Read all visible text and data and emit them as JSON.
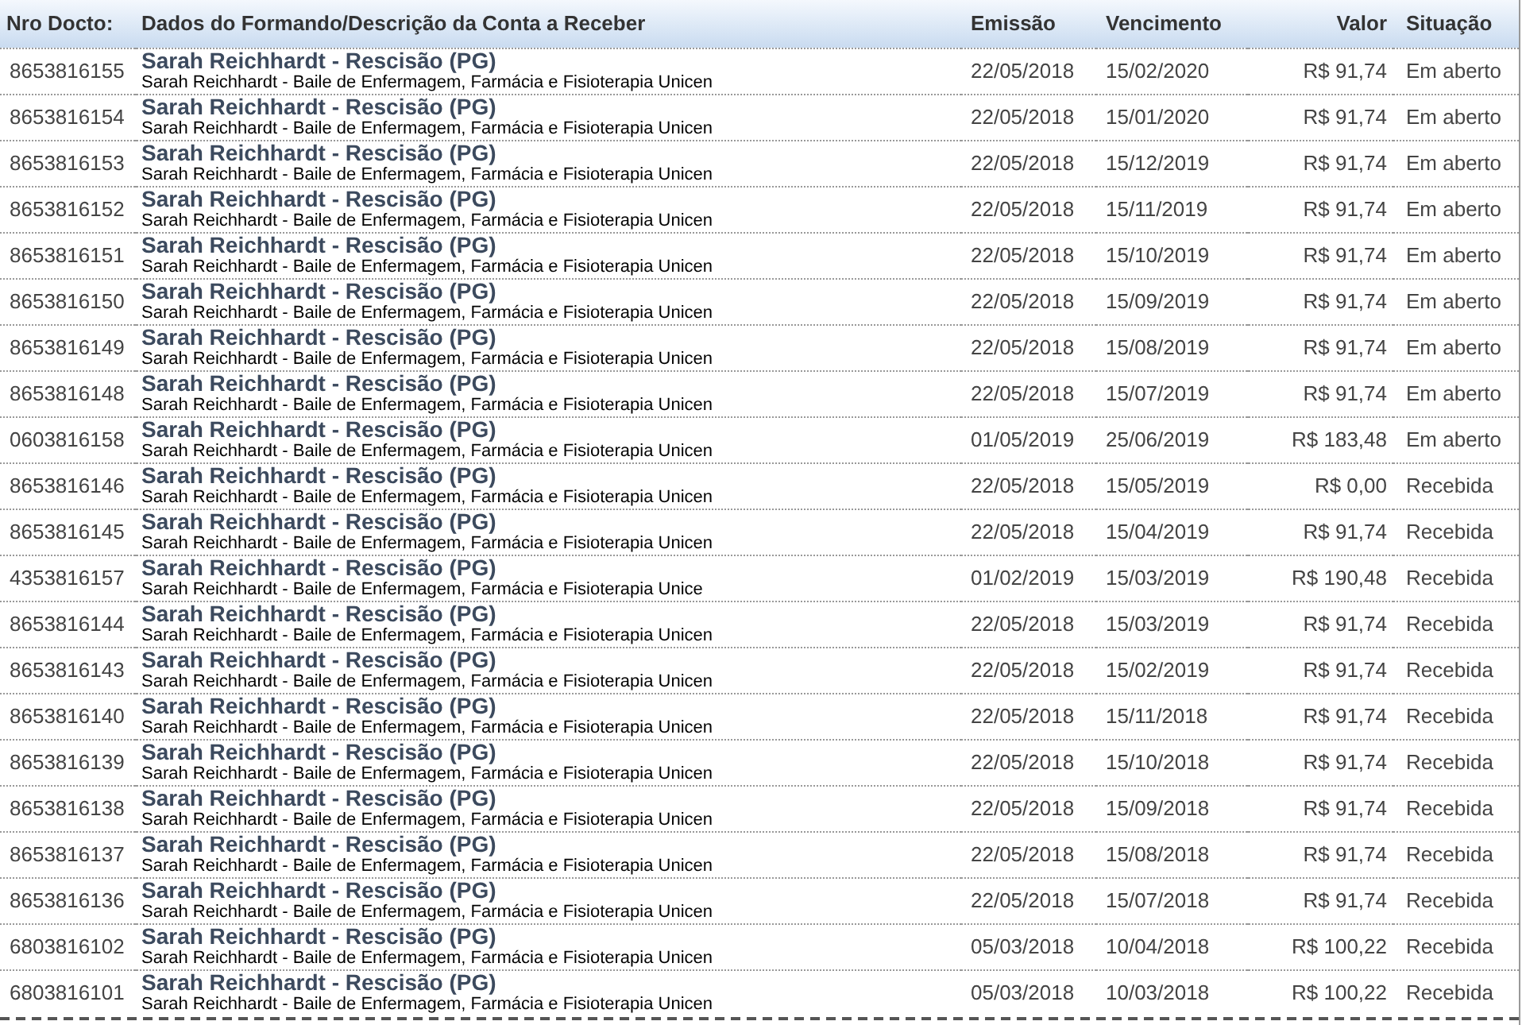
{
  "table": {
    "columns": [
      "Nro Docto:",
      "Dados do Formando/Descrição da Conta a Receber",
      "Emissão",
      "Vencimento",
      "Valor",
      "Situação"
    ],
    "rows": [
      {
        "doc": "8653816155",
        "title": "Sarah Reichhardt - Rescisão (PG)",
        "desc": "Sarah Reichhardt - Baile de Enfermagem, Farmácia e Fisioterapia Unicen",
        "issued": "22/05/2018",
        "due": "15/02/2020",
        "amount": "R$ 91,74",
        "status": "Em aberto"
      },
      {
        "doc": "8653816154",
        "title": "Sarah Reichhardt - Rescisão (PG)",
        "desc": "Sarah Reichhardt - Baile de Enfermagem, Farmácia e Fisioterapia Unicen",
        "issued": "22/05/2018",
        "due": "15/01/2020",
        "amount": "R$ 91,74",
        "status": "Em aberto"
      },
      {
        "doc": "8653816153",
        "title": "Sarah Reichhardt - Rescisão (PG)",
        "desc": "Sarah Reichhardt - Baile de Enfermagem, Farmácia e Fisioterapia Unicen",
        "issued": "22/05/2018",
        "due": "15/12/2019",
        "amount": "R$ 91,74",
        "status": "Em aberto"
      },
      {
        "doc": "8653816152",
        "title": "Sarah Reichhardt - Rescisão (PG)",
        "desc": "Sarah Reichhardt - Baile de Enfermagem, Farmácia e Fisioterapia Unicen",
        "issued": "22/05/2018",
        "due": "15/11/2019",
        "amount": "R$ 91,74",
        "status": "Em aberto"
      },
      {
        "doc": "8653816151",
        "title": "Sarah Reichhardt - Rescisão (PG)",
        "desc": "Sarah Reichhardt - Baile de Enfermagem, Farmácia e Fisioterapia Unicen",
        "issued": "22/05/2018",
        "due": "15/10/2019",
        "amount": "R$ 91,74",
        "status": "Em aberto"
      },
      {
        "doc": "8653816150",
        "title": "Sarah Reichhardt - Rescisão (PG)",
        "desc": "Sarah Reichhardt - Baile de Enfermagem, Farmácia e Fisioterapia Unicen",
        "issued": "22/05/2018",
        "due": "15/09/2019",
        "amount": "R$ 91,74",
        "status": "Em aberto"
      },
      {
        "doc": "8653816149",
        "title": "Sarah Reichhardt - Rescisão (PG)",
        "desc": "Sarah Reichhardt - Baile de Enfermagem, Farmácia e Fisioterapia Unicen",
        "issued": "22/05/2018",
        "due": "15/08/2019",
        "amount": "R$ 91,74",
        "status": "Em aberto"
      },
      {
        "doc": "8653816148",
        "title": "Sarah Reichhardt - Rescisão (PG)",
        "desc": "Sarah Reichhardt - Baile de Enfermagem, Farmácia e Fisioterapia Unicen",
        "issued": "22/05/2018",
        "due": "15/07/2019",
        "amount": "R$ 91,74",
        "status": "Em aberto"
      },
      {
        "doc": "0603816158",
        "title": "Sarah Reichhardt - Rescisão (PG)",
        "desc": "Sarah Reichhardt - Baile de Enfermagem, Farmácia e Fisioterapia Unicen",
        "issued": "01/05/2019",
        "due": "25/06/2019",
        "amount": "R$ 183,48",
        "status": "Em aberto"
      },
      {
        "doc": "8653816146",
        "title": "Sarah Reichhardt - Rescisão (PG)",
        "desc": "Sarah Reichhardt - Baile de Enfermagem, Farmácia e Fisioterapia Unicen",
        "issued": "22/05/2018",
        "due": "15/05/2019",
        "amount": "R$ 0,00",
        "status": "Recebida"
      },
      {
        "doc": "8653816145",
        "title": "Sarah Reichhardt - Rescisão (PG)",
        "desc": "Sarah Reichhardt - Baile de Enfermagem, Farmácia e Fisioterapia Unicen",
        "issued": "22/05/2018",
        "due": "15/04/2019",
        "amount": "R$ 91,74",
        "status": "Recebida"
      },
      {
        "doc": "4353816157",
        "title": "Sarah Reichhardt - Rescisão (PG)",
        "desc": "Sarah Reichhardt - Baile de Enfermagem, Farmácia e Fisioterapia Unice",
        "issued": "01/02/2019",
        "due": "15/03/2019",
        "amount": "R$ 190,48",
        "status": "Recebida"
      },
      {
        "doc": "8653816144",
        "title": "Sarah Reichhardt - Rescisão (PG)",
        "desc": "Sarah Reichhardt - Baile de Enfermagem, Farmácia e Fisioterapia Unicen",
        "issued": "22/05/2018",
        "due": "15/03/2019",
        "amount": "R$ 91,74",
        "status": "Recebida"
      },
      {
        "doc": "8653816143",
        "title": "Sarah Reichhardt - Rescisão (PG)",
        "desc": "Sarah Reichhardt - Baile de Enfermagem, Farmácia e Fisioterapia Unicen",
        "issued": "22/05/2018",
        "due": "15/02/2019",
        "amount": "R$ 91,74",
        "status": "Recebida"
      },
      {
        "doc": "8653816140",
        "title": "Sarah Reichhardt - Rescisão (PG)",
        "desc": "Sarah Reichhardt - Baile de Enfermagem, Farmácia e Fisioterapia Unicen",
        "issued": "22/05/2018",
        "due": "15/11/2018",
        "amount": "R$ 91,74",
        "status": "Recebida"
      },
      {
        "doc": "8653816139",
        "title": "Sarah Reichhardt - Rescisão (PG)",
        "desc": "Sarah Reichhardt - Baile de Enfermagem, Farmácia e Fisioterapia Unicen",
        "issued": "22/05/2018",
        "due": "15/10/2018",
        "amount": "R$ 91,74",
        "status": "Recebida"
      },
      {
        "doc": "8653816138",
        "title": "Sarah Reichhardt - Rescisão (PG)",
        "desc": "Sarah Reichhardt - Baile de Enfermagem, Farmácia e Fisioterapia Unicen",
        "issued": "22/05/2018",
        "due": "15/09/2018",
        "amount": "R$ 91,74",
        "status": "Recebida"
      },
      {
        "doc": "8653816137",
        "title": "Sarah Reichhardt - Rescisão (PG)",
        "desc": "Sarah Reichhardt - Baile de Enfermagem, Farmácia e Fisioterapia Unicen",
        "issued": "22/05/2018",
        "due": "15/08/2018",
        "amount": "R$ 91,74",
        "status": "Recebida"
      },
      {
        "doc": "8653816136",
        "title": "Sarah Reichhardt - Rescisão (PG)",
        "desc": "Sarah Reichhardt - Baile de Enfermagem, Farmácia e Fisioterapia Unicen",
        "issued": "22/05/2018",
        "due": "15/07/2018",
        "amount": "R$ 91,74",
        "status": "Recebida"
      },
      {
        "doc": "6803816102",
        "title": "Sarah Reichhardt - Rescisão (PG)",
        "desc": "Sarah Reichhardt - Baile de Enfermagem, Farmácia e Fisioterapia Unicen",
        "issued": "05/03/2018",
        "due": "10/04/2018",
        "amount": "R$ 100,22",
        "status": "Recebida"
      },
      {
        "doc": "6803816101",
        "title": "Sarah Reichhardt - Rescisão (PG)",
        "desc": "Sarah Reichhardt - Baile de Enfermagem, Farmácia e Fisioterapia Unicen",
        "issued": "05/03/2018",
        "due": "10/03/2018",
        "amount": "R$ 100,22",
        "status": "Recebida"
      }
    ]
  }
}
